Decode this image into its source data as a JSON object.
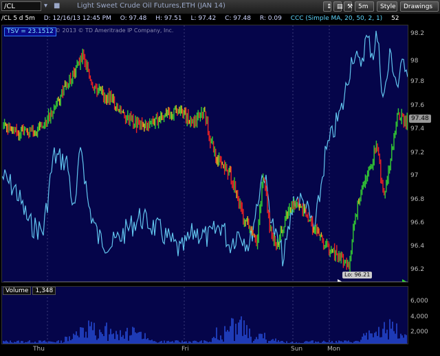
{
  "toolbar": {
    "symbol": "/CL",
    "title": "Light Sweet Crude Oil Futures,ETH (JAN 14)",
    "timeframe": "5m",
    "style_label": "Style",
    "drawings_label": "Drawings"
  },
  "infobar": {
    "chart_tag": "/CL 5 d 5m",
    "date": "D: 12/16/13 12:45 PM",
    "open": "O: 97.48",
    "high": "H: 97.51",
    "low": "L: 97.42",
    "close": "C: 97.48",
    "range": "R: 0.09",
    "study": "CCC (Simple MA, 20, 50, 2, 1)",
    "study_value": "52"
  },
  "overlay": {
    "tsv_label": "TSV = 23.1512",
    "copyright": "© 2013 © TD Ameritrade IP Company, Inc.",
    "last_price": "97.48",
    "low_flag": "Lo: 96.21"
  },
  "y_axis": [
    "98.2",
    "98",
    "97.8",
    "97.6",
    "97.4",
    "97.2",
    "97",
    "96.8",
    "96.6",
    "96.4",
    "96.2"
  ],
  "volume": {
    "label": "Volume",
    "value": "1,348",
    "axis": [
      "6,000",
      "4,000",
      "2,000"
    ]
  },
  "x_axis": [
    "Thu",
    "Fri",
    "Sun",
    "Mon"
  ],
  "colors": {
    "background": "#05054a",
    "tsv_line": "#62c6ef",
    "up_bar": "#33cc33",
    "down_bar": "#ee2222",
    "neutral_bar": "#e8c020",
    "volume_bar": "#2f5fff",
    "arrow_white": "#ffffff",
    "arrow_green": "#22dd22"
  }
}
